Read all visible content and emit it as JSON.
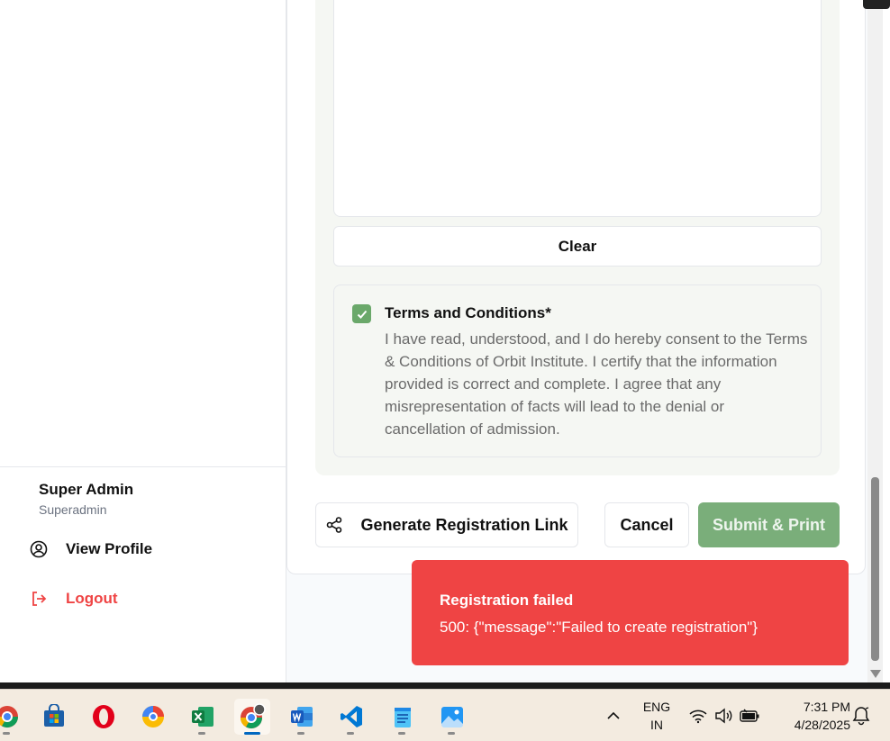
{
  "sidebar": {
    "user_name": "Super Admin",
    "user_role": "Superadmin",
    "view_profile_label": "View Profile",
    "logout_label": "Logout"
  },
  "form": {
    "clear_label": "Clear",
    "terms_title": "Terms and Conditions*",
    "terms_text": "I have read, understood, and I do hereby consent to the Terms & Conditions of Orbit Institute. I certify that the information provided is correct and complete. I agree that any misrepresentation of facts will lead to the denial or cancellation of admission.",
    "terms_checked": true,
    "generate_link_label": "Generate Registration Link",
    "cancel_label": "Cancel",
    "submit_label": "Submit & Print"
  },
  "toast": {
    "title": "Registration failed",
    "message": "500: {\"message\":\"Failed to create registration\"}"
  },
  "taskbar": {
    "apps": [
      "chrome-icon",
      "microsoft-store-icon",
      "opera-icon",
      "chrome-canary-icon",
      "excel-icon",
      "chrome-profile-icon",
      "word-icon",
      "vscode-icon",
      "notepad-icon",
      "photos-icon"
    ],
    "lang_line1": "ENG",
    "lang_line2": "IN",
    "time": "7:31 PM",
    "date": "4/28/2025"
  },
  "colors": {
    "accent_green": "#7aae7a",
    "danger": "#ef4444",
    "toast_bg": "#ef4444"
  }
}
